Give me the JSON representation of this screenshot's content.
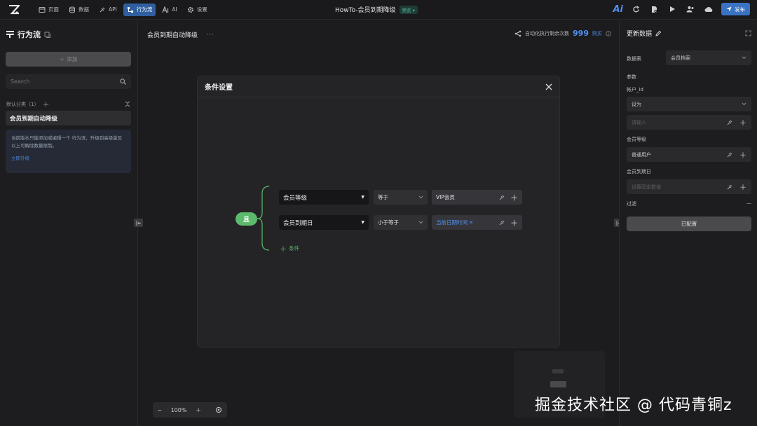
{
  "colors": {
    "accent": "#3a73c4",
    "green": "#5cba6c",
    "link": "#4f8ff0",
    "bg": "#1c1c1e"
  },
  "topbar": {
    "nav": [
      {
        "label": "页面",
        "icon": "page-icon"
      },
      {
        "label": "数据",
        "icon": "database-icon"
      },
      {
        "label": "API",
        "icon": "api-icon"
      },
      {
        "label": "行为流",
        "icon": "flow-icon",
        "active": true
      },
      {
        "label": "AI",
        "icon": "ai-icon"
      },
      {
        "label": "设置",
        "icon": "gear-icon"
      }
    ],
    "doc_title": "HowTo-会员到期降级",
    "mode_badge": "预览 ▾",
    "ai_label": "Ai",
    "publish_label": "发布"
  },
  "sidebar": {
    "title": "行为流",
    "add_label": "添加",
    "search_placeholder": "Search",
    "category_label": "默认分类（1）",
    "flow_item": "会员到期自动降级",
    "notice_text": "当前版本只能添加或编辑一个 行为流，升级到高级版及以上可解除数量限制。",
    "notice_link": "立即升级"
  },
  "canvas": {
    "flow_title": "会员到期自动降级",
    "exec_label": "自动化执行剩余次数",
    "exec_count": "999",
    "buy_label": "购买",
    "zoom_level": "100%"
  },
  "modal": {
    "title": "条件设置",
    "group_op": "且",
    "conditions": [
      {
        "field": "会员等级",
        "operator": "等于",
        "value": "VIP会员",
        "value_type": "text"
      },
      {
        "field": "会员到期日",
        "operator": "小于等于",
        "value": "当前日期时间",
        "value_type": "dynamic"
      }
    ],
    "add_condition": "条件"
  },
  "rpanel": {
    "title": "更新数据",
    "table_label": "数据表",
    "table_value": "会员档案",
    "params_label": "参数",
    "account_id_label": "帐户_id",
    "account_mode": "设为",
    "account_placeholder": "请输入",
    "level_label": "会员等级",
    "level_value": "普通用户",
    "expire_label": "会员到期日",
    "expire_placeholder": "设置固定数值",
    "filter_label": "过滤",
    "filter_value": "—",
    "configured_label": "已配置"
  },
  "watermark": "掘金技术社区 @ 代码青铜z"
}
